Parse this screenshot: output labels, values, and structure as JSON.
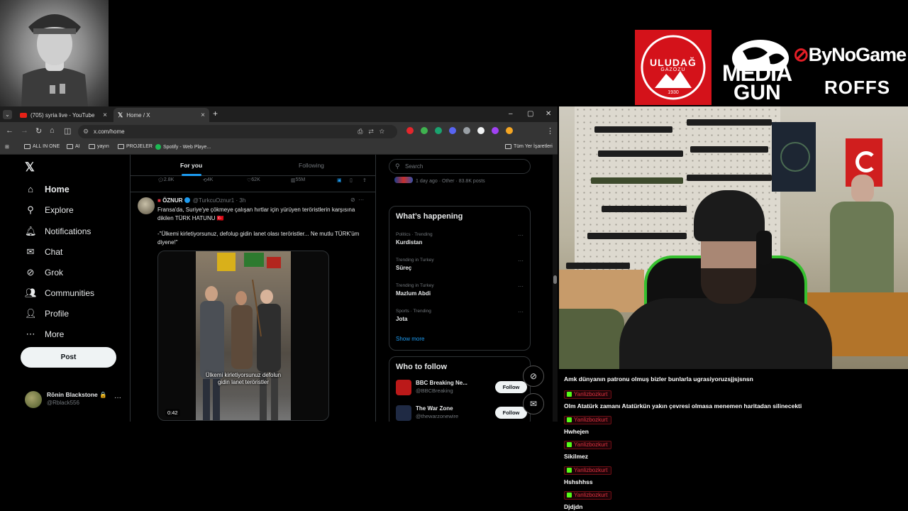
{
  "sponsors": {
    "uludag_name": "ULUDAĞ",
    "uludag_sub": "GAZOZU",
    "uludag_year": "1930",
    "mediagun_line1": "MEDIA",
    "mediagun_line2": "GUN",
    "bynogame": "ByNoGame",
    "roffs": "ROFFS"
  },
  "browser": {
    "tabs": [
      {
        "label": "(705) syria live - YouTube",
        "favicon": "youtube-icon",
        "active": false
      },
      {
        "label": "Home / X",
        "favicon": "x-icon",
        "active": true
      }
    ],
    "tab_close": "×",
    "new_tab": "+",
    "window_controls": {
      "minimize": "–",
      "maximize": "▢",
      "close": "✕"
    },
    "nav": {
      "back": "←",
      "forward": "→",
      "reload": "↻",
      "home": "⌂",
      "split": "◫"
    },
    "url": "x.com/home",
    "bookmarks": [
      {
        "label": "ALL IN ONE",
        "icon": "folder-icon"
      },
      {
        "label": "AI",
        "icon": "folder-icon"
      },
      {
        "label": "yayın",
        "icon": "folder-icon"
      },
      {
        "label": "PROJELER",
        "icon": "folder-icon"
      },
      {
        "label": "Spotify - Web Playe...",
        "icon": "spotify-icon"
      }
    ],
    "all_bookmarks": "Tüm Yer İşaretleri",
    "extension_colors": [
      "#e5262c",
      "#3fb34f",
      "#1aa36f",
      "#5865f2",
      "#9aa0a6",
      "#f1f3f4",
      "#a142f4",
      "#f5a623"
    ]
  },
  "x": {
    "logo": "𝕏",
    "nav": [
      {
        "label": "Home",
        "icon": "home-icon",
        "glyph": "⌂"
      },
      {
        "label": "Explore",
        "icon": "search-icon",
        "glyph": "⚲"
      },
      {
        "label": "Notifications",
        "icon": "bell-icon",
        "glyph": "🔔︎"
      },
      {
        "label": "Chat",
        "icon": "mail-icon",
        "glyph": "✉"
      },
      {
        "label": "Grok",
        "icon": "grok-icon",
        "glyph": "⊘"
      },
      {
        "label": "Communities",
        "icon": "communities-icon",
        "glyph": "👥︎"
      },
      {
        "label": "Profile",
        "icon": "person-icon",
        "glyph": "👤︎"
      },
      {
        "label": "More",
        "icon": "more-circle-icon",
        "glyph": "⋯"
      }
    ],
    "post_button": "Post",
    "profile": {
      "name": "Rōnin Blackstone 🔒",
      "handle": "@Rblack556",
      "more": "···"
    },
    "timeline_tabs": {
      "for_you": "For you",
      "following": "Following"
    },
    "action_counts": {
      "replies": "2.8K",
      "reposts": "4K",
      "likes": "62K",
      "views": "55M"
    },
    "tweet": {
      "name": "ÖZNUR",
      "handle": "@TurkcuOznur1",
      "time": "· 3h",
      "text_1": "Fransa'da, Suriye'ye çökmeye çalışan hırtlar için yürüyen teröristlerin karşısına dikilen TÜRK HATUNU 🇹🇷",
      "text_2": "-\"Ülkemi kirletiyorsunuz, defolup gidin lanet olası teröristler... Ne mutlu TÜRK'üm diyene!\"",
      "video_caption": "Ülkemi kirletiyorsunuz defolun gidin lanet teröristler",
      "video_time": "0:42"
    },
    "search_placeholder": "Search",
    "partial_trend": "1 day ago · Other · 83.8K posts",
    "whats_happening_title": "What’s happening",
    "trends": [
      {
        "meta": "Politics · Trending",
        "name": "Kurdistan"
      },
      {
        "meta": "Trending in Turkey",
        "name": "Süreç"
      },
      {
        "meta": "Trending in Turkey",
        "name": "Mazlum Abdi"
      },
      {
        "meta": "Sports · Trending",
        "name": "Jota"
      }
    ],
    "trend_more": "···",
    "show_more": "Show more",
    "who_to_follow_title": "Who to follow",
    "follow_suggestions": [
      {
        "name": "BBC Breaking Ne...",
        "handle": "@BBCBreaking",
        "avatar_color": "#bb1919",
        "button": "Follow"
      },
      {
        "name": "The War Zone",
        "handle": "@thewarzonewire",
        "avatar_color": "#1f2a44",
        "button": "Follow"
      }
    ],
    "accent": "#1d9bf0"
  },
  "chat": {
    "messages": [
      {
        "user": "",
        "text": "Amk dünyanın patronu olmuş bizler bunlarla ugrasiyoruzsjjsjsnsn"
      },
      {
        "user": "Yanlizbozkurt",
        "text": "Olm Atatürk zamanı Atatürkün yakın çevresi olmasa menemen haritadan silinecekti"
      },
      {
        "user": "Yanlizbozkurt",
        "text": "Hwhejen"
      },
      {
        "user": "Yanlizbozkurt",
        "text": "Sikilmez"
      },
      {
        "user": "Yanlizbozkurt",
        "text": "Hshshhss"
      },
      {
        "user": "Yanlizbozkurt",
        "text": "Djdjdn"
      }
    ]
  }
}
